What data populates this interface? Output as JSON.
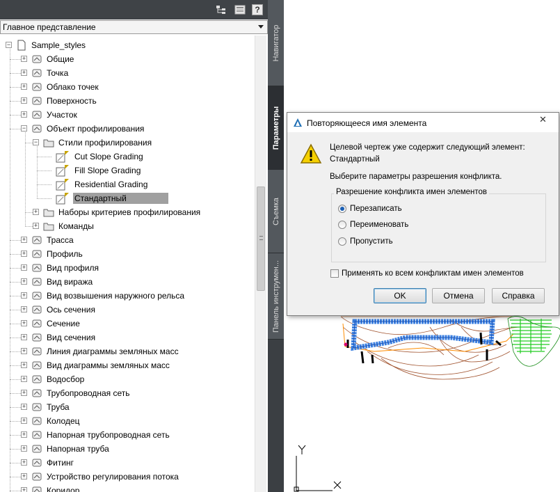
{
  "panel": {
    "view_selector": "Главное представление",
    "tree": [
      {
        "label": "Sample_styles",
        "icon": "drawing-file-icon",
        "level": 0,
        "expander": "minus"
      },
      {
        "label": "Общие",
        "icon": "general-settings-icon",
        "level": 1,
        "expander": "plus"
      },
      {
        "label": "Точка",
        "icon": "point-icon",
        "level": 1,
        "expander": "plus"
      },
      {
        "label": "Облако точек",
        "icon": "point-cloud-icon",
        "level": 1,
        "expander": "plus"
      },
      {
        "label": "Поверхность",
        "icon": "surface-icon",
        "level": 1,
        "expander": "plus"
      },
      {
        "label": "Участок",
        "icon": "site-icon",
        "level": 1,
        "expander": "plus"
      },
      {
        "label": "Объект профилирования",
        "icon": "grading-object-icon",
        "level": 1,
        "expander": "minus"
      },
      {
        "label": "Стили профилирования",
        "icon": "folder-open-icon",
        "level": 2,
        "expander": "minus"
      },
      {
        "label": "Cut Slope Grading",
        "icon": "grading-style-icon",
        "level": 3,
        "expander": ""
      },
      {
        "label": "Fill Slope Grading",
        "icon": "grading-style-icon",
        "level": 3,
        "expander": ""
      },
      {
        "label": "Residential Grading",
        "icon": "grading-style-icon",
        "level": 3,
        "expander": ""
      },
      {
        "label": "Стандартный",
        "icon": "grading-style-icon",
        "level": 3,
        "expander": "",
        "selected": true
      },
      {
        "label": "Наборы критериев профилирования",
        "icon": "folder-icon",
        "level": 2,
        "expander": "plus"
      },
      {
        "label": "Команды",
        "icon": "folder-icon",
        "level": 2,
        "expander": "plus"
      },
      {
        "label": "Трасса",
        "icon": "alignment-icon",
        "level": 1,
        "expander": "plus"
      },
      {
        "label": "Профиль",
        "icon": "profile-icon",
        "level": 1,
        "expander": "plus"
      },
      {
        "label": "Вид профиля",
        "icon": "profile-view-icon",
        "level": 1,
        "expander": "plus"
      },
      {
        "label": "Вид виража",
        "icon": "superelevation-view-icon",
        "level": 1,
        "expander": "plus"
      },
      {
        "label": "Вид возвышения наружного рельса",
        "icon": "cant-view-icon",
        "level": 1,
        "expander": "plus"
      },
      {
        "label": "Ось сечения",
        "icon": "sample-line-icon",
        "level": 1,
        "expander": "plus"
      },
      {
        "label": "Сечение",
        "icon": "section-icon",
        "level": 1,
        "expander": "plus"
      },
      {
        "label": "Вид сечения",
        "icon": "section-view-icon",
        "level": 1,
        "expander": "plus"
      },
      {
        "label": "Линия диаграммы земляных масс",
        "icon": "mass-haul-line-icon",
        "level": 1,
        "expander": "plus"
      },
      {
        "label": "Вид диаграммы земляных масс",
        "icon": "mass-haul-view-icon",
        "level": 1,
        "expander": "plus"
      },
      {
        "label": "Водосбор",
        "icon": "catchment-icon",
        "level": 1,
        "expander": "plus"
      },
      {
        "label": "Трубопроводная сеть",
        "icon": "pipe-network-icon",
        "level": 1,
        "expander": "plus"
      },
      {
        "label": "Труба",
        "icon": "pipe-icon",
        "level": 1,
        "expander": "plus"
      },
      {
        "label": "Колодец",
        "icon": "structure-icon",
        "level": 1,
        "expander": "plus"
      },
      {
        "label": "Напорная трубопроводная сеть",
        "icon": "pressure-network-icon",
        "level": 1,
        "expander": "plus"
      },
      {
        "label": "Напорная труба",
        "icon": "pressure-pipe-icon",
        "level": 1,
        "expander": "plus"
      },
      {
        "label": "Фитинг",
        "icon": "fitting-icon",
        "level": 1,
        "expander": "plus"
      },
      {
        "label": "Устройство регулирования потока",
        "icon": "appurtenance-icon",
        "level": 1,
        "expander": "plus"
      },
      {
        "label": "Коридор",
        "icon": "corridor-icon",
        "level": 1,
        "expander": "plus"
      }
    ]
  },
  "vertical_tabs": [
    {
      "label": "Навигатор",
      "active": false
    },
    {
      "label": "Параметры",
      "active": true
    },
    {
      "label": "Съемка",
      "active": false
    },
    {
      "label": "Панель инструмен...",
      "active": false
    }
  ],
  "drawing": {
    "ucs_y_label": "Y",
    "ucs_x_label": "X"
  },
  "dialog": {
    "title": "Повторяющееся имя элемента",
    "close_symbol": "✕",
    "message_line1": "Целевой чертеж уже содержит следующий элемент:",
    "message_line2": "Стандартный",
    "instruction": "Выберите параметры разрешения конфликта.",
    "group_title": "Разрешение конфликта имен элементов",
    "options": [
      {
        "label": "Перезаписать",
        "selected": true
      },
      {
        "label": "Переименовать",
        "selected": false
      },
      {
        "label": "Пропустить",
        "selected": false
      }
    ],
    "apply_all_label": "Применять ко всем конфликтам имен элементов",
    "apply_all_checked": false,
    "buttons": {
      "ok": "OK",
      "cancel": "Отмена",
      "help": "Справка"
    }
  },
  "colors": {
    "toolbar_bg": "#3f4347",
    "tab_strip_bg": "#3b3f43",
    "selection": "#a0a0a0",
    "style_badge": "#c8a400",
    "corridor_blue": "#3a7fe0",
    "contour_brown": "#a0522d",
    "hatch_green": "#22cc22"
  }
}
